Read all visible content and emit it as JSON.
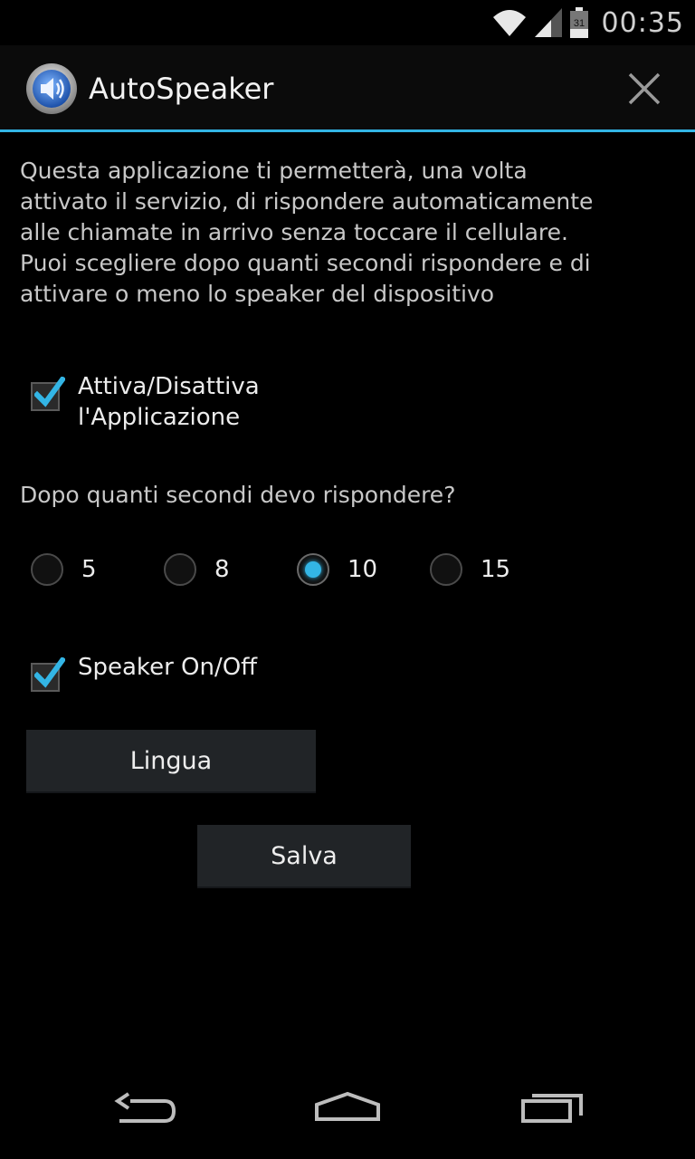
{
  "status_bar": {
    "time": "00:35",
    "battery_level": "31",
    "icons": [
      "wifi-icon",
      "signal-icon",
      "battery-icon"
    ]
  },
  "app_bar": {
    "title": "AutoSpeaker",
    "icon": "speaker-icon",
    "close_icon": "close-icon",
    "accent_color": "#33b5e5"
  },
  "main": {
    "description": "Questa applicazione ti permetterà, una volta attivato il servizio, di rispondere automaticamente alle chiamate in arrivo senza toccare il cellulare. Puoi scegliere dopo quanti secondi rispondere e di attivare o meno lo speaker del dispositivo",
    "toggle_app": {
      "label_line1": "Attiva/Disattiva",
      "label_line2": "l'Applicazione",
      "checked": true
    },
    "question": "Dopo quanti secondi devo rispondere?",
    "seconds_options": [
      "5",
      "8",
      "10",
      "15"
    ],
    "seconds_selected": "10",
    "speaker_toggle": {
      "label": "Speaker On/Off",
      "checked": true
    },
    "language_button": "Lingua",
    "save_button": "Salva"
  },
  "nav_bar": {
    "icons": [
      "back-icon",
      "home-icon",
      "recent-apps-icon"
    ]
  }
}
